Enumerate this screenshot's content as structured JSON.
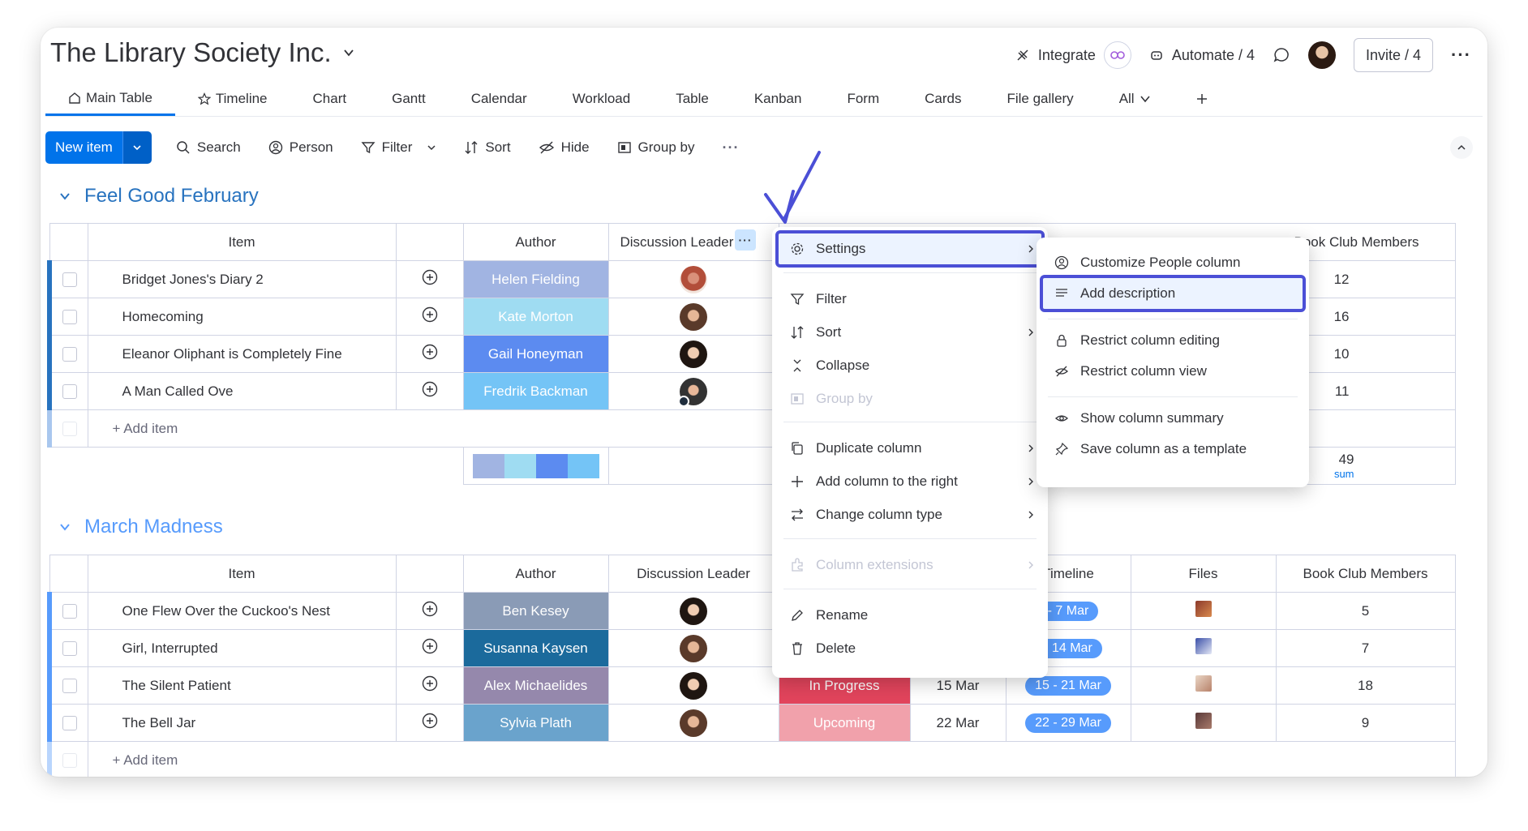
{
  "board": {
    "title": "The Library Society Inc.",
    "integrate_label": "Integrate",
    "automate_label": "Automate / 4",
    "invite_label": "Invite / 4"
  },
  "tabs": [
    {
      "label": "Main Table",
      "icon": "home-icon",
      "active": true
    },
    {
      "label": "Timeline",
      "icon": "star-icon"
    },
    {
      "label": "Chart"
    },
    {
      "label": "Gantt"
    },
    {
      "label": "Calendar"
    },
    {
      "label": "Workload"
    },
    {
      "label": "Table"
    },
    {
      "label": "Kanban"
    },
    {
      "label": "Form"
    },
    {
      "label": "Cards"
    },
    {
      "label": "File gallery"
    },
    {
      "label": "All"
    }
  ],
  "toolbar": {
    "new_item": "New item",
    "search": "Search",
    "person": "Person",
    "filter": "Filter",
    "sort": "Sort",
    "hide": "Hide",
    "group_by": "Group by"
  },
  "groups": {
    "feb": {
      "title": "Feel Good February",
      "color": "#2873bf",
      "headers": {
        "item": "Item",
        "author": "Author",
        "leader": "Discussion Leader",
        "members": "Book Club Members"
      },
      "rows": [
        {
          "item": "Bridget Jones's Diary 2",
          "author": "Helen Fielding",
          "author_color": "#a1b4e2",
          "members": "12"
        },
        {
          "item": "Homecoming",
          "author": "Kate Morton",
          "author_color": "#9fdcf2",
          "members": "16"
        },
        {
          "item": "Eleanor Oliphant is Completely Fine",
          "author": "Gail Honeyman",
          "author_color": "#5c8bf0",
          "members": "10"
        },
        {
          "item": "A Man Called Ove",
          "author": "Fredrik Backman",
          "author_color": "#74c4f6",
          "members": "11"
        }
      ],
      "add_item": "+ Add item",
      "sum_value": "49",
      "sum_label": "sum"
    },
    "mar": {
      "title": "March Madness",
      "color": "#579bfc",
      "headers": {
        "item": "Item",
        "author": "Author",
        "leader": "Discussion Leader",
        "timeline": "Timeline",
        "files": "Files",
        "members": "Book Club Members"
      },
      "rows": [
        {
          "item": "One Flew Over the Cuckoo's Nest",
          "author": "Ben Kesey",
          "author_color": "#8a9bb6",
          "status": "",
          "date": "",
          "timeline": "- 7 Mar",
          "members": "5"
        },
        {
          "item": "Girl, Interrupted",
          "author": "Susanna Kaysen",
          "author_color": "#1b6a9c",
          "status": "",
          "date": "",
          "timeline": "- 14 Mar",
          "members": "7"
        },
        {
          "item": "The Silent Patient",
          "author": "Alex Michaelides",
          "author_color": "#9588ac",
          "status": "In Progress",
          "status_color": "#e2445c",
          "date": "15 Mar",
          "timeline": "15 - 21 Mar",
          "members": "18"
        },
        {
          "item": "The Bell Jar",
          "author": "Sylvia Plath",
          "author_color": "#6aa3cc",
          "status": "Upcoming",
          "status_color": "#f1a1ab",
          "date": "22 Mar",
          "timeline": "22 - 29 Mar",
          "members": "9"
        }
      ],
      "add_item": "+ Add item"
    }
  },
  "column_menu": {
    "items": [
      {
        "label": "Settings",
        "icon": "gear-icon",
        "submenu": true
      },
      {
        "label": "Filter",
        "icon": "filter-icon"
      },
      {
        "label": "Sort",
        "icon": "sort-icon",
        "submenu": true
      },
      {
        "label": "Collapse",
        "icon": "collapse-icon"
      },
      {
        "label": "Group by",
        "icon": "group-by-icon",
        "disabled": true
      },
      {
        "label": "Duplicate column",
        "icon": "duplicate-icon",
        "submenu": true
      },
      {
        "label": "Add column to the right",
        "icon": "plus-icon",
        "submenu": true
      },
      {
        "label": "Change column type",
        "icon": "swap-icon",
        "submenu": true
      },
      {
        "label": "Column extensions",
        "icon": "extensions-icon",
        "submenu": true,
        "disabled": true
      },
      {
        "label": "Rename",
        "icon": "pencil-icon"
      },
      {
        "label": "Delete",
        "icon": "trash-icon"
      }
    ]
  },
  "settings_submenu": {
    "items": [
      {
        "label": "Customize People column",
        "icon": "person-circle-icon"
      },
      {
        "label": "Add description",
        "icon": "lines-icon"
      },
      {
        "label": "Restrict column editing",
        "icon": "lock-icon"
      },
      {
        "label": "Restrict column view",
        "icon": "eye-off-icon"
      },
      {
        "label": "Show column summary",
        "icon": "eye-icon"
      },
      {
        "label": "Save column as a template",
        "icon": "pin-icon"
      }
    ]
  },
  "colors": {
    "accent": "#0073ea",
    "highlight": "#4b4fd6"
  }
}
